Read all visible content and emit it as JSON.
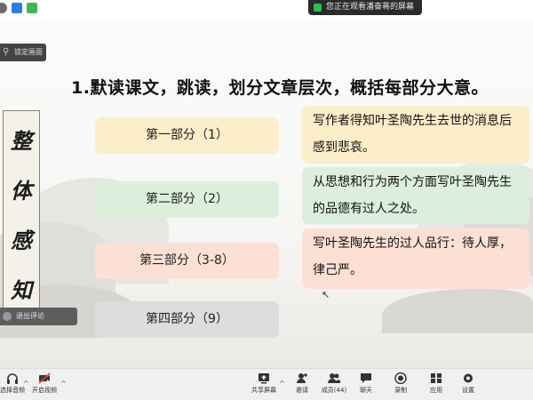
{
  "share_banner": {
    "text": "您正在观看潘奋蒋的屏幕"
  },
  "pin_button": {
    "label": "锁定画面"
  },
  "slide": {
    "title": "1.默读课文，跳读，划分文章层次，概括每部分大意。",
    "scroll_chars": [
      "整",
      "体",
      "感",
      "知"
    ],
    "parts": [
      {
        "label": "第一部分（1）",
        "color": "#fbeec9",
        "desc": "写作者得知叶圣陶先生去世的消息后感到悲哀。"
      },
      {
        "label": "第二部分（2）",
        "color": "#dcefdc",
        "desc": "从思想和行为两个方面写叶圣陶先生的品德有过人之处。"
      },
      {
        "label": "第三部分（3-8）",
        "color": "#fbe0d3",
        "desc": "写叶圣陶先生的过人品行：待人厚，律己严。"
      },
      {
        "label": "第四部分（9）",
        "color": "#dddddd",
        "desc": ""
      }
    ]
  },
  "review_pill": {
    "label": "退出评论"
  },
  "toolbar": {
    "audio": "选择音频",
    "video": "开启视频",
    "share": "共享屏幕",
    "invite": "邀请",
    "members": "成员(44)",
    "chat": "聊天",
    "record": "录制",
    "apps": "应用",
    "settings": "设置"
  }
}
